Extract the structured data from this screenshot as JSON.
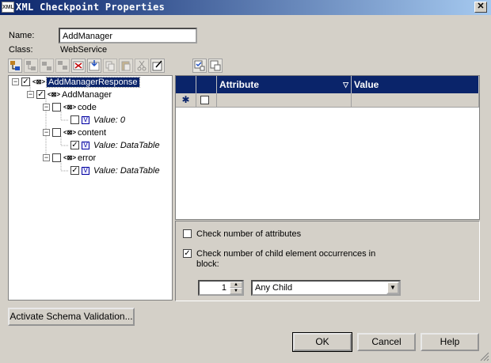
{
  "window": {
    "title": "XML Checkpoint Properties",
    "icon_text": "XML",
    "close_glyph": "✕"
  },
  "fields": {
    "name_label": "Name:",
    "name_value": "AddManager",
    "class_label": "Class:",
    "class_value": "WebService"
  },
  "tree": {
    "nodes": [
      {
        "label": "AddManagerResponse"
      },
      {
        "label": "AddManager"
      },
      {
        "label": "code"
      },
      {
        "label": "Value: 0"
      },
      {
        "label": "content"
      },
      {
        "label": "Value: DataTable"
      },
      {
        "label": "error"
      },
      {
        "label": "Value: DataTable"
      }
    ]
  },
  "grid": {
    "col_attribute": "Attribute",
    "col_value": "Value",
    "new_row_marker": "✱"
  },
  "options": {
    "check_attributes_label": "Check number of attributes",
    "check_children_label_line1": "Check number of child element occurrences in",
    "check_children_label_line2": "block:",
    "spin_value": "1",
    "child_select_value": "Any Child"
  },
  "buttons": {
    "schema_validation": "Activate Schema Validation...",
    "ok": "OK",
    "cancel": "Cancel",
    "help": "Help"
  },
  "icons": {
    "toolbar_left": [
      "add-child-icon",
      "add-sibling-icon",
      "add-before-icon",
      "add-after-icon",
      "delete-xml-icon",
      "import-xml-icon",
      "copy-icon",
      "paste-icon",
      "cut-icon",
      "edit-icon"
    ],
    "toolbar_right": [
      "select-icon",
      "deselect-icon"
    ]
  }
}
